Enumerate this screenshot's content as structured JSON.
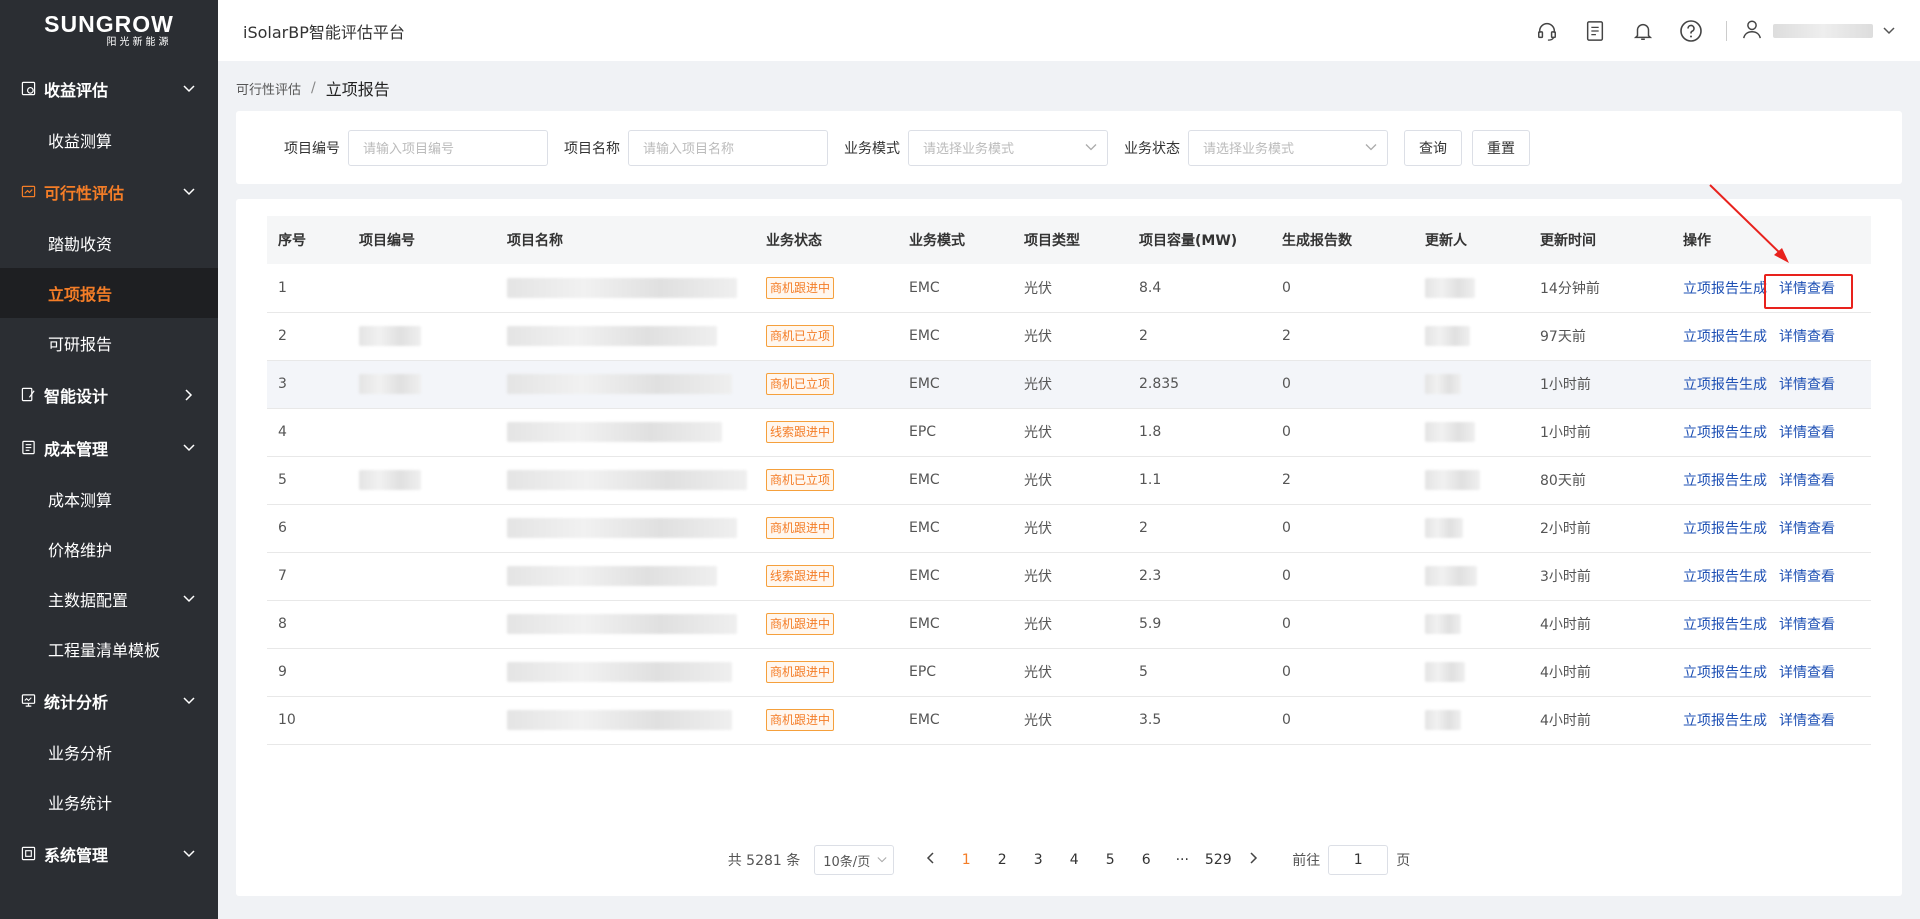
{
  "brand": {
    "logo_main": "SUNGROW",
    "logo_sub": "阳光新能源"
  },
  "header": {
    "app_title": "iSolarBP智能评估平台"
  },
  "sidebar": {
    "groups": [
      {
        "label": "收益评估",
        "items": [
          {
            "label": "收益测算"
          }
        ]
      },
      {
        "label": "可行性评估",
        "items": [
          {
            "label": "踏勘收资"
          },
          {
            "label": "立项报告"
          },
          {
            "label": "可研报告"
          }
        ]
      },
      {
        "label": "智能设计"
      },
      {
        "label": "成本管理",
        "items": [
          {
            "label": "成本测算"
          },
          {
            "label": "价格维护"
          },
          {
            "label": "主数据配置"
          },
          {
            "label": "工程量清单模板"
          }
        ]
      },
      {
        "label": "统计分析",
        "items": [
          {
            "label": "业务分析"
          },
          {
            "label": "业务统计"
          }
        ]
      },
      {
        "label": "系统管理"
      }
    ]
  },
  "breadcrumb": {
    "parent": "可行性评估",
    "separator": "/",
    "current": "立项报告"
  },
  "filters": {
    "project_no_label": "项目编号",
    "project_no_placeholder": "请输入项目编号",
    "project_name_label": "项目名称",
    "project_name_placeholder": "请输入项目名称",
    "biz_mode_label": "业务模式",
    "biz_mode_placeholder": "请选择业务模式",
    "biz_status_label": "业务状态",
    "biz_status_placeholder": "请选择业务模式",
    "query_label": "查询",
    "reset_label": "重置"
  },
  "table": {
    "headers": [
      "序号",
      "项目编号",
      "项目名称",
      "业务状态",
      "业务模式",
      "项目类型",
      "项目容量(MW)",
      "生成报告数",
      "更新人",
      "更新时间",
      "操作"
    ],
    "action_generate": "立项报告生成",
    "action_detail": "详情查看",
    "rows": [
      {
        "no": "1",
        "status": "商机跟进中",
        "mode": "EMC",
        "type": "光伏",
        "capacity": "8.4",
        "reports": "0",
        "time": "14分钟前"
      },
      {
        "no": "2",
        "status": "商机已立项",
        "mode": "EMC",
        "type": "光伏",
        "capacity": "2",
        "reports": "2",
        "time": "97天前"
      },
      {
        "no": "3",
        "status": "商机已立项",
        "mode": "EMC",
        "type": "光伏",
        "capacity": "2.835",
        "reports": "0",
        "time": "1小时前"
      },
      {
        "no": "4",
        "status": "线索跟进中",
        "mode": "EPC",
        "type": "光伏",
        "capacity": "1.8",
        "reports": "0",
        "time": "1小时前"
      },
      {
        "no": "5",
        "status": "商机已立项",
        "mode": "EMC",
        "type": "光伏",
        "capacity": "1.1",
        "reports": "2",
        "time": "80天前"
      },
      {
        "no": "6",
        "status": "商机跟进中",
        "mode": "EMC",
        "type": "光伏",
        "capacity": "2",
        "reports": "0",
        "time": "2小时前"
      },
      {
        "no": "7",
        "status": "线索跟进中",
        "mode": "EMC",
        "type": "光伏",
        "capacity": "2.3",
        "reports": "0",
        "time": "3小时前"
      },
      {
        "no": "8",
        "status": "商机跟进中",
        "mode": "EMC",
        "type": "光伏",
        "capacity": "5.9",
        "reports": "0",
        "time": "4小时前"
      },
      {
        "no": "9",
        "status": "商机跟进中",
        "mode": "EPC",
        "type": "光伏",
        "capacity": "5",
        "reports": "0",
        "time": "4小时前"
      },
      {
        "no": "10",
        "status": "商机跟进中",
        "mode": "EMC",
        "type": "光伏",
        "capacity": "3.5",
        "reports": "0",
        "time": "4小时前"
      }
    ]
  },
  "pagination": {
    "total_text": "共 5281 条",
    "page_size": "10条/页",
    "pages": [
      "1",
      "2",
      "3",
      "4",
      "5",
      "6",
      "···",
      "529"
    ],
    "current_page": "1",
    "goto_label": "前往",
    "goto_value": "1",
    "goto_suffix": "页"
  },
  "colors": {
    "accent": "#f47d27",
    "sidebar_bg": "#2b2e33",
    "link": "#1e50b4",
    "annotation": "#e8221d"
  },
  "icons": [
    "headset-icon",
    "document-icon",
    "bell-icon",
    "help-icon",
    "user-icon"
  ]
}
